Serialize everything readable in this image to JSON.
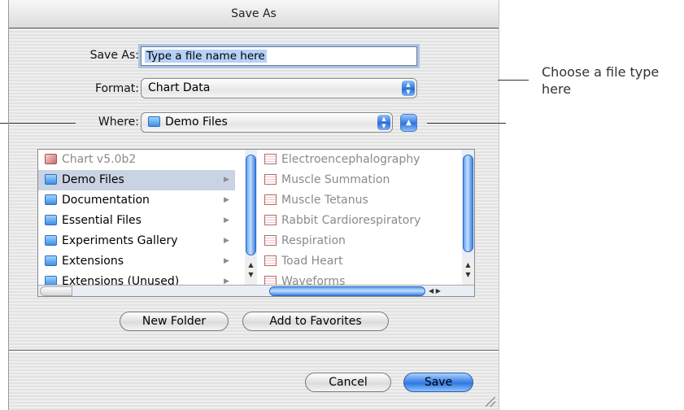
{
  "dialog": {
    "title": "Save As",
    "save_as_label": "Save As:",
    "filename_value": "Type a file name here",
    "format_label": "Format:",
    "format_value": "Chart Data",
    "where_label": "Where:",
    "where_value": "Demo Files"
  },
  "browser": {
    "left_column": [
      {
        "label": "Chart v5.0b2",
        "icon": "application-icon",
        "selected": false,
        "dimmed": true
      },
      {
        "label": "Demo Files",
        "icon": "folder-icon",
        "selected": true,
        "dimmed": false
      },
      {
        "label": "Documentation",
        "icon": "folder-icon",
        "selected": false,
        "dimmed": false
      },
      {
        "label": "Essential Files",
        "icon": "folder-icon",
        "selected": false,
        "dimmed": false
      },
      {
        "label": "Experiments Gallery",
        "icon": "folder-icon",
        "selected": false,
        "dimmed": false
      },
      {
        "label": "Extensions",
        "icon": "folder-icon",
        "selected": false,
        "dimmed": false
      },
      {
        "label": "Extensions (Unused)",
        "icon": "folder-icon",
        "selected": false,
        "dimmed": false
      }
    ],
    "right_column": [
      {
        "label": "Electroencephalography",
        "icon": "chart-document-icon"
      },
      {
        "label": "Muscle Summation",
        "icon": "chart-document-icon"
      },
      {
        "label": "Muscle Tetanus",
        "icon": "chart-document-icon"
      },
      {
        "label": "Rabbit Cardiorespiratory",
        "icon": "chart-document-icon"
      },
      {
        "label": "Respiration",
        "icon": "chart-document-icon"
      },
      {
        "label": "Toad Heart",
        "icon": "chart-document-icon"
      },
      {
        "label": "Waveforms",
        "icon": "chart-document-icon"
      }
    ]
  },
  "buttons": {
    "new_folder": "New Folder",
    "add_to_favorites": "Add to Favorites",
    "cancel": "Cancel",
    "save": "Save"
  },
  "annotation": {
    "callout_text": "Choose a file type here"
  },
  "colors": {
    "accent": "#2f78e1",
    "selection": "#c9d3e3"
  }
}
